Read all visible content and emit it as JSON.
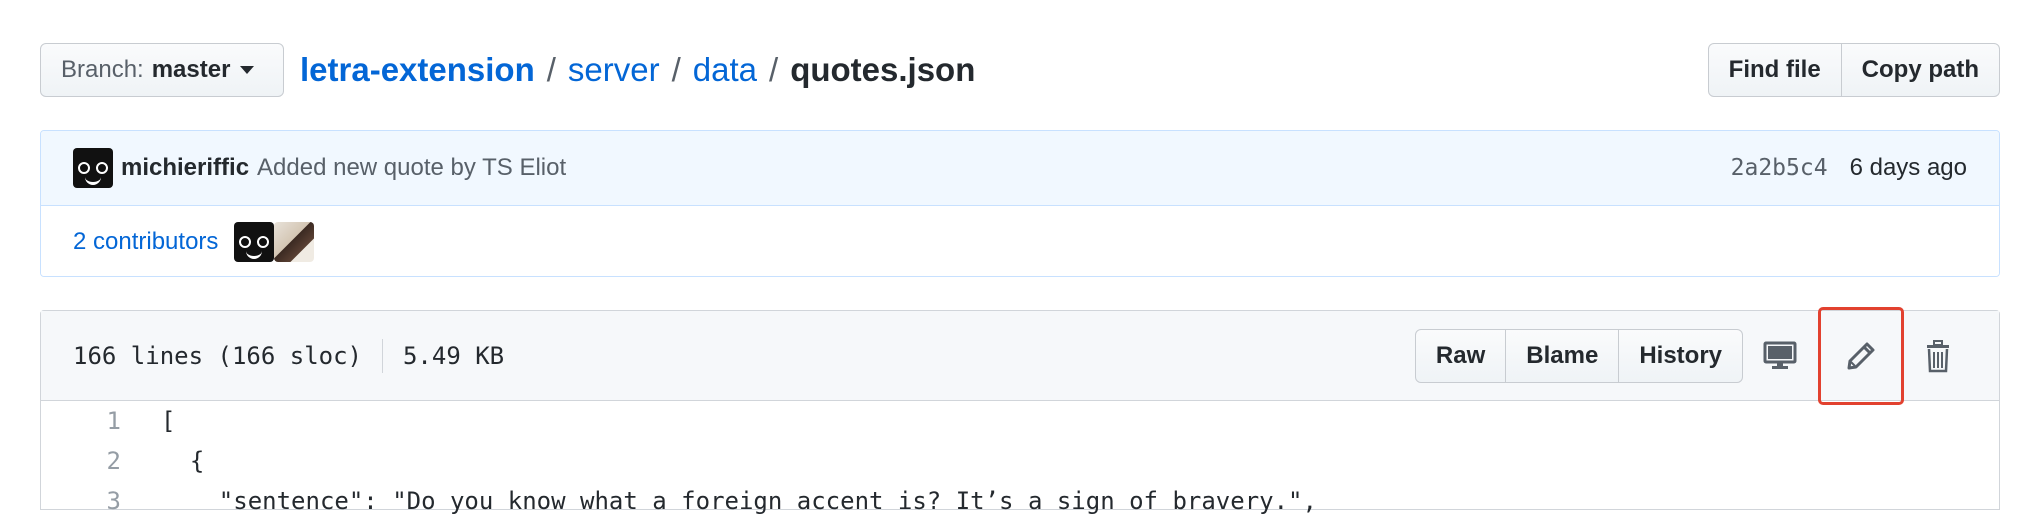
{
  "branch": {
    "label": "Branch:",
    "value": "master"
  },
  "breadcrumb": {
    "repo": "letra-extension",
    "sep": "/",
    "dir1": "server",
    "dir2": "data",
    "file": "quotes.json"
  },
  "top_actions": {
    "find_file": "Find file",
    "copy_path": "Copy path"
  },
  "commit": {
    "author": "michieriffic",
    "message": "Added new quote by TS Eliot",
    "sha": "2a2b5c4",
    "time": "6 days ago"
  },
  "contributors": {
    "label": "2 contributors"
  },
  "file": {
    "lines": "166 lines (166 sloc)",
    "size": "5.49 KB",
    "buttons": {
      "raw": "Raw",
      "blame": "Blame",
      "history": "History"
    }
  },
  "code": [
    {
      "num": "1",
      "text": "["
    },
    {
      "num": "2",
      "text": "  {"
    },
    {
      "num": "3",
      "text": "    \"sentence\": \"Do you know what a foreign accent is? It’s a sign of bravery.\","
    }
  ],
  "colors": {
    "link": "#0366d6",
    "highlight": "#e2412f",
    "commit_bg": "#f1f8ff"
  }
}
